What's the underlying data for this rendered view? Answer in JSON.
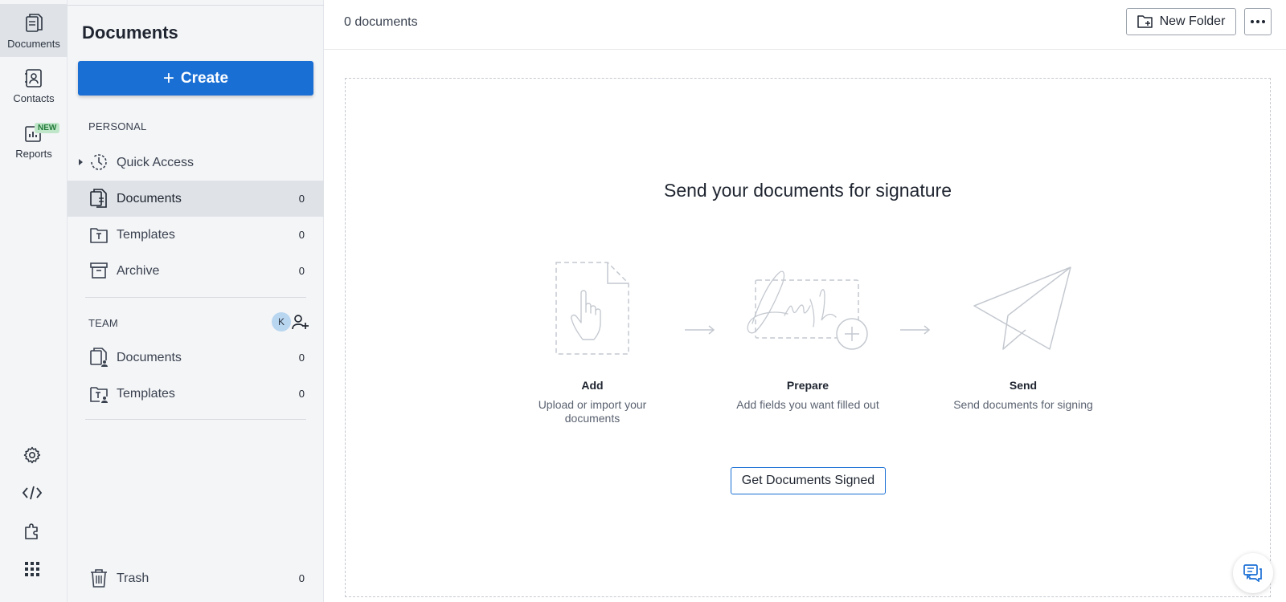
{
  "rail": {
    "items": [
      {
        "label": "Documents",
        "icon": "documents-icon",
        "active": true
      },
      {
        "label": "Contacts",
        "icon": "contacts-icon"
      },
      {
        "label": "Reports",
        "icon": "reports-icon",
        "badge": "NEW"
      }
    ],
    "bottom_icons": [
      "settings-icon",
      "code-icon",
      "puzzle-icon",
      "apps-grid-icon"
    ]
  },
  "sidebar": {
    "title": "Documents",
    "create_label": "Create",
    "personal_label": "PERSONAL",
    "personal_items": [
      {
        "label": "Quick Access",
        "count": ""
      },
      {
        "label": "Documents",
        "count": "0"
      },
      {
        "label": "Templates",
        "count": "0"
      },
      {
        "label": "Archive",
        "count": "0"
      }
    ],
    "team_label": "TEAM",
    "team_avatar": "K",
    "team_items": [
      {
        "label": "Documents",
        "count": "0"
      },
      {
        "label": "Templates",
        "count": "0"
      }
    ],
    "trash": {
      "label": "Trash",
      "count": "0"
    }
  },
  "main": {
    "doc_count": "0 documents",
    "new_folder_label": "New Folder",
    "hero_title": "Send your documents for signature",
    "steps": [
      {
        "title": "Add",
        "desc": "Upload or import your documents"
      },
      {
        "title": "Prepare",
        "desc": "Add fields you want filled out"
      },
      {
        "title": "Send",
        "desc": "Send documents for signing"
      }
    ],
    "cta_label": "Get Documents Signed"
  },
  "colors": {
    "accent": "#1a6fd5",
    "sidebar_bg": "#f4f5f7",
    "active_bg": "#dfe3e8"
  }
}
